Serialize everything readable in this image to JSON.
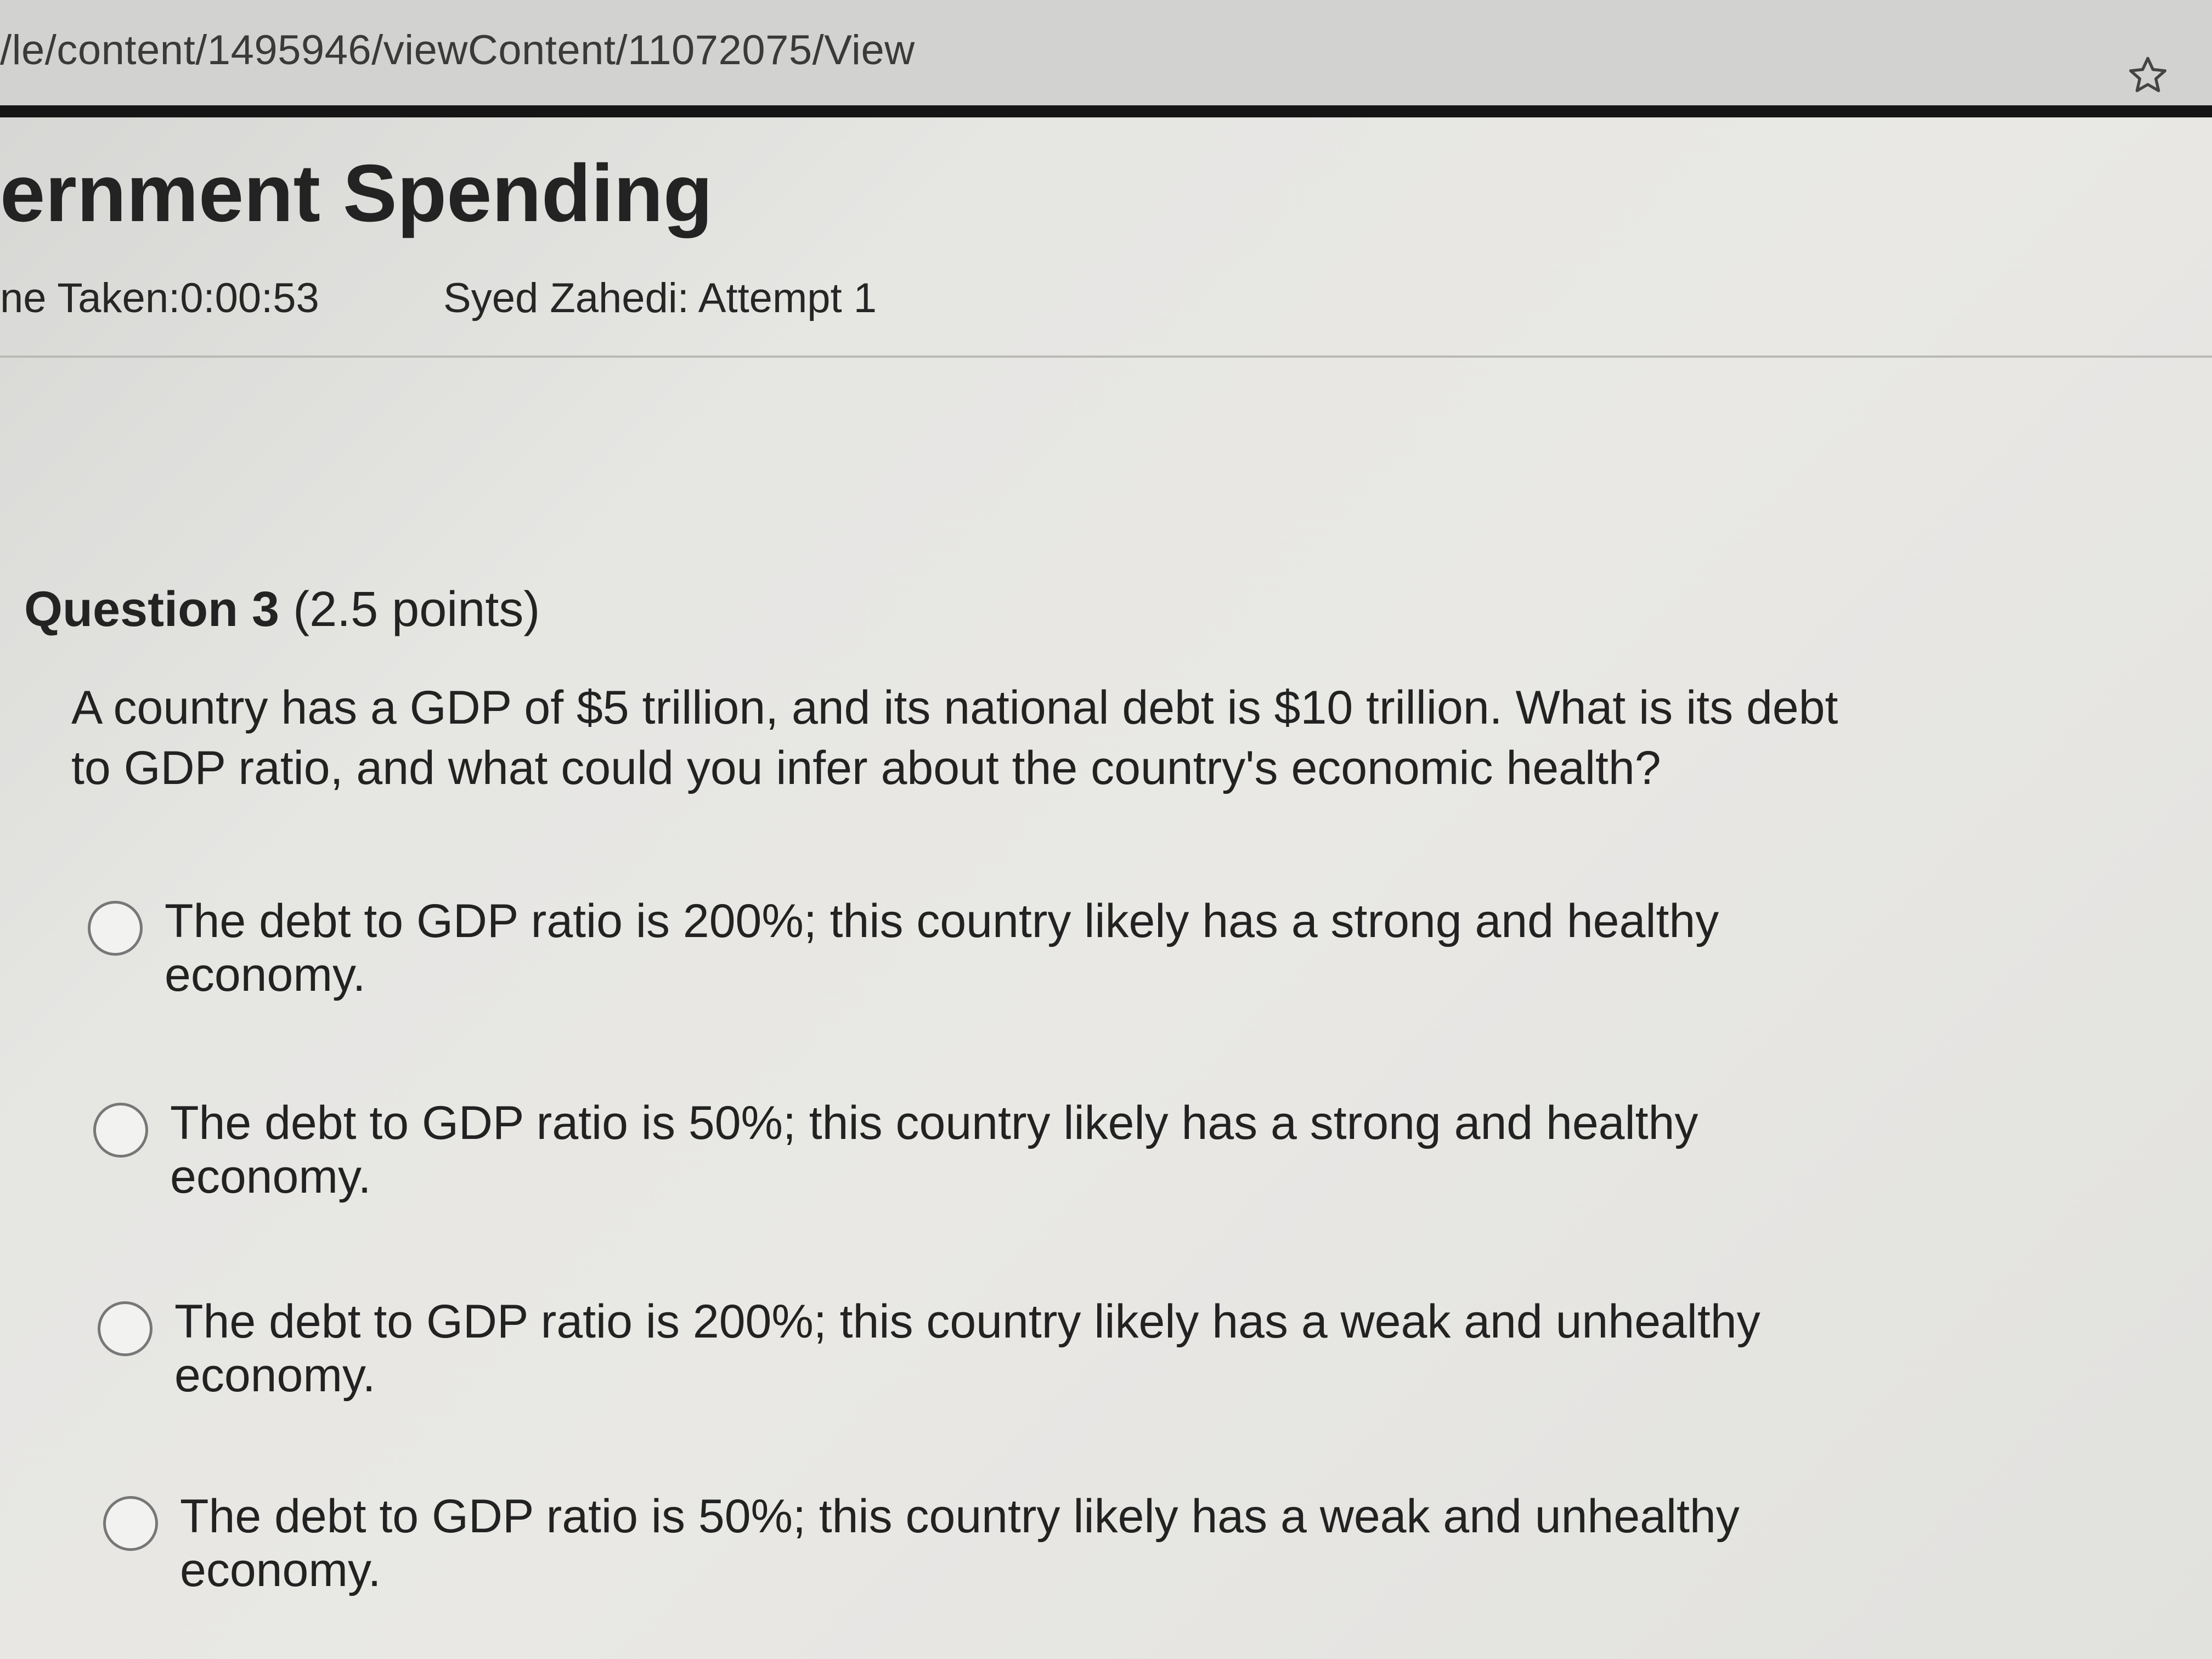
{
  "browser": {
    "url": "/le/content/1495946/viewContent/11072075/View",
    "bookmark_icon": "star-outline-icon"
  },
  "quiz": {
    "title": "ernment Spending",
    "time_taken": "ne Taken:0:00:53",
    "attempt_label": "Syed Zahedi: Attempt 1"
  },
  "question": {
    "label": "Question 3",
    "points": "(2.5 points)",
    "text": "A country has a GDP of $5 trillion, and its national debt is $10 trillion. What is its debt to GDP ratio, and what could you infer about the country's economic health?",
    "options": [
      {
        "label": "The debt to GDP ratio is 200%; this country likely has a strong and healthy economy.",
        "selected": false
      },
      {
        "label": "The debt to GDP ratio is 50%; this country likely has a strong and healthy economy.",
        "selected": false
      },
      {
        "label": "The debt to GDP ratio is 200%; this country likely has a weak and unhealthy economy.",
        "selected": false
      },
      {
        "label": "The debt to GDP ratio is 50%; this country likely has a weak and unhealthy economy.",
        "selected": false
      }
    ]
  }
}
